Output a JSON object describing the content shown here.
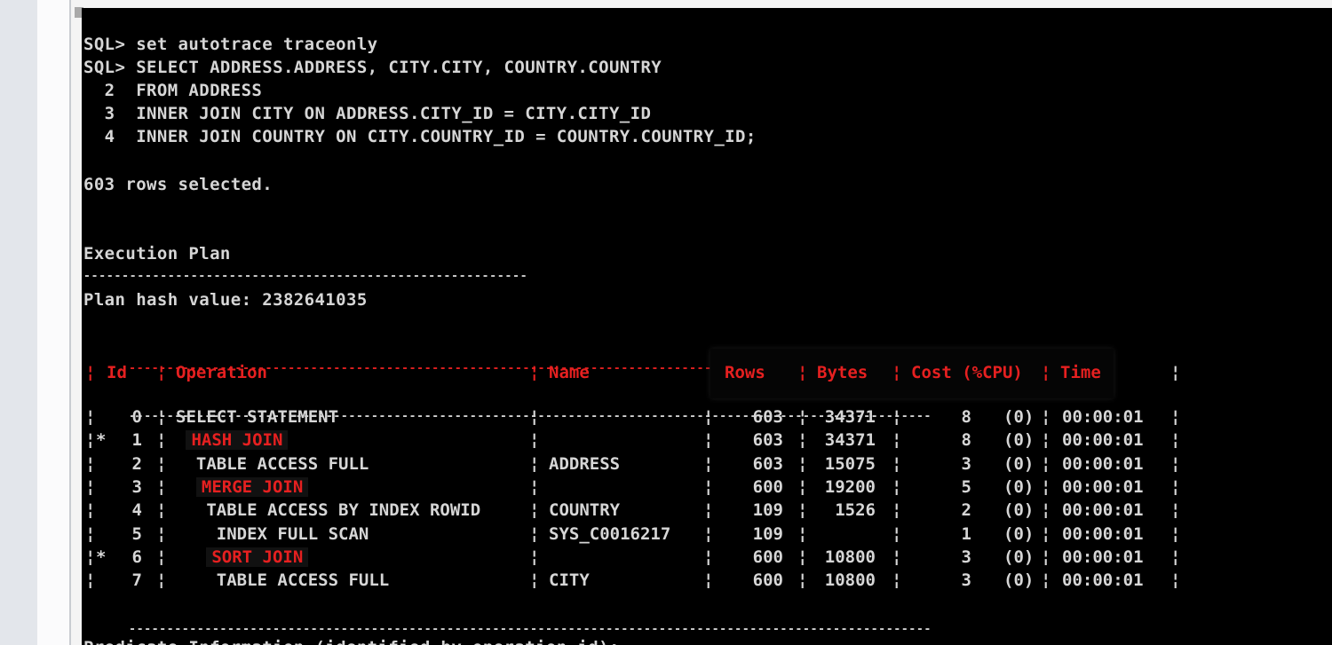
{
  "console": {
    "lines": [
      "SQL> set autotrace traceonly",
      "SQL> SELECT ADDRESS.ADDRESS, CITY.CITY, COUNTRY.COUNTRY",
      "  2  FROM ADDRESS",
      "  3  INNER JOIN CITY ON ADDRESS.CITY_ID = CITY.CITY_ID",
      "  4  INNER JOIN COUNTRY ON CITY.COUNTRY_ID = COUNTRY.COUNTRY_ID;",
      "603 rows selected.",
      "Execution Plan",
      "Plan hash value: 2382641035"
    ],
    "rule_short": "----------------------------------------------------------",
    "rule_long": "----------------------------------------------------------------------------------------------------",
    "rule_long_tail": "------",
    "footer_partial": "Predicate Information (identified by operation id):"
  },
  "plan": {
    "headers": {
      "id": "Id",
      "operation": "Operation",
      "name": "Name",
      "rows": "Rows",
      "bytes": "Bytes",
      "cost": "Cost (%CPU)",
      "time": "Time"
    },
    "rows": [
      {
        "flag": "",
        "id": "0",
        "operation": "SELECT STATEMENT",
        "name": "",
        "rows": "603",
        "bytes": "34371",
        "cost": "8",
        "cpu": "(0)",
        "time": "00:00:01",
        "highlight": false
      },
      {
        "flag": "*",
        "id": "1",
        "operation": " HASH JOIN",
        "name": "",
        "rows": "603",
        "bytes": "34371",
        "cost": "8",
        "cpu": "(0)",
        "time": "00:00:01",
        "highlight": true
      },
      {
        "flag": "",
        "id": "2",
        "operation": "  TABLE ACCESS FULL",
        "name": "ADDRESS",
        "rows": "603",
        "bytes": "15075",
        "cost": "3",
        "cpu": "(0)",
        "time": "00:00:01",
        "highlight": false
      },
      {
        "flag": "",
        "id": "3",
        "operation": "  MERGE JOIN",
        "name": "",
        "rows": "600",
        "bytes": "19200",
        "cost": "5",
        "cpu": "(0)",
        "time": "00:00:01",
        "highlight": true
      },
      {
        "flag": "",
        "id": "4",
        "operation": "   TABLE ACCESS BY INDEX ROWID",
        "name": "COUNTRY",
        "rows": "109",
        "bytes": "1526",
        "cost": "2",
        "cpu": "(0)",
        "time": "00:00:01",
        "highlight": false
      },
      {
        "flag": "",
        "id": "5",
        "operation": "    INDEX FULL SCAN",
        "name": "SYS_C0016217",
        "rows": "109",
        "bytes": "",
        "cost": "1",
        "cpu": "(0)",
        "time": "00:00:01",
        "highlight": false
      },
      {
        "flag": "*",
        "id": "6",
        "operation": "   SORT JOIN",
        "name": "",
        "rows": "600",
        "bytes": "10800",
        "cost": "3",
        "cpu": "(0)",
        "time": "00:00:01",
        "highlight": true
      },
      {
        "flag": "",
        "id": "7",
        "operation": "    TABLE ACCESS FULL",
        "name": "CITY",
        "rows": "600",
        "bytes": "10800",
        "cost": "3",
        "cpu": "(0)",
        "time": "00:00:01",
        "highlight": false
      }
    ]
  }
}
